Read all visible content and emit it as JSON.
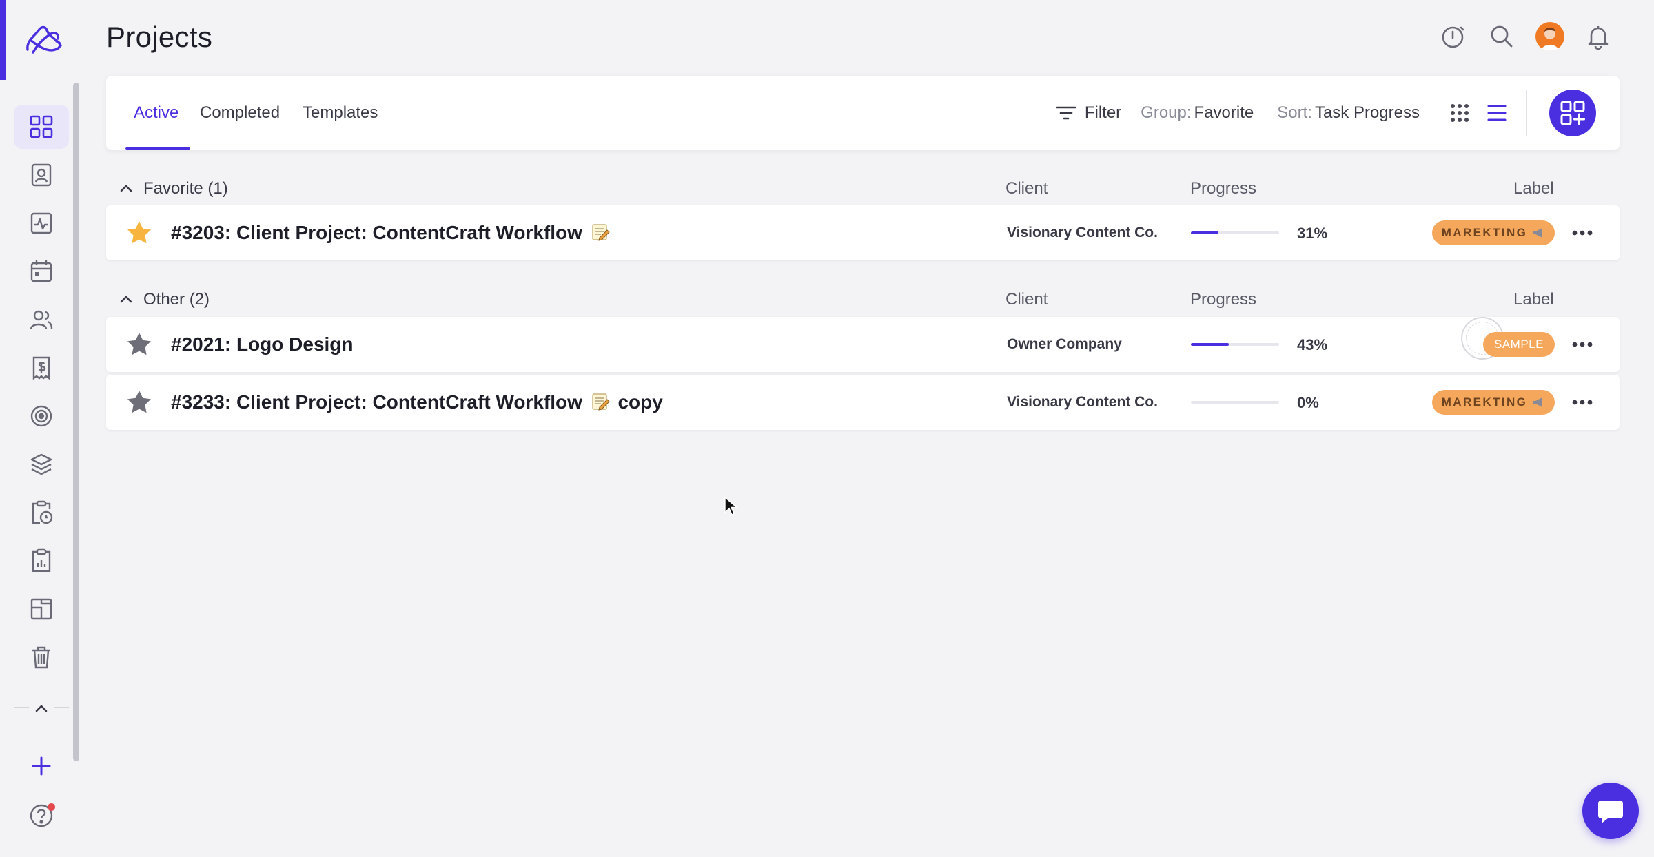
{
  "app": {
    "page_title": "Projects",
    "accent_color": "#4a2fe0"
  },
  "sidebar": {
    "items": [
      {
        "icon": "dashboard-grid-icon",
        "active": true
      },
      {
        "icon": "contact-card-icon"
      },
      {
        "icon": "activity-icon"
      },
      {
        "icon": "calendar-icon"
      },
      {
        "icon": "people-icon"
      },
      {
        "icon": "invoice-dollar-icon"
      },
      {
        "icon": "target-icon"
      },
      {
        "icon": "layers-icon"
      },
      {
        "icon": "timesheet-clipboard-icon"
      },
      {
        "icon": "report-clipboard-icon"
      },
      {
        "icon": "board-icon"
      },
      {
        "icon": "trash-icon"
      }
    ]
  },
  "header_icons": [
    "timer-icon",
    "search-icon",
    "avatar",
    "bell-icon"
  ],
  "tabs": {
    "active": "Active",
    "completed": "Completed",
    "templates": "Templates"
  },
  "toolbar": {
    "filter_label": "Filter",
    "group_prefix": "Group:",
    "group_value": "Favorite",
    "sort_prefix": "Sort:",
    "sort_value": "Task Progress"
  },
  "columns": {
    "client": "Client",
    "progress": "Progress",
    "label": "Label"
  },
  "groups": [
    {
      "title": "Favorite (1)",
      "rows": [
        {
          "title_main": "#3203: Client Project: ContentCraft Workflow",
          "title_suffix": "",
          "favorite": true,
          "client": "Visionary Content Co.",
          "progress": 31,
          "progress_text": "31%",
          "label": "MAREKTING"
        }
      ]
    },
    {
      "title": "Other (2)",
      "rows": [
        {
          "title_main": "#2021: Logo Design",
          "favorite": false,
          "client": "Owner Company",
          "progress": 43,
          "progress_text": "43%",
          "label": "SAMPLE"
        },
        {
          "title_main": "#3233: Client Project: ContentCraft Workflow",
          "title_suffix": "copy",
          "favorite": false,
          "client": "Visionary Content Co.",
          "progress": 0,
          "progress_text": "0%",
          "label": "MAREKTING"
        }
      ]
    }
  ]
}
